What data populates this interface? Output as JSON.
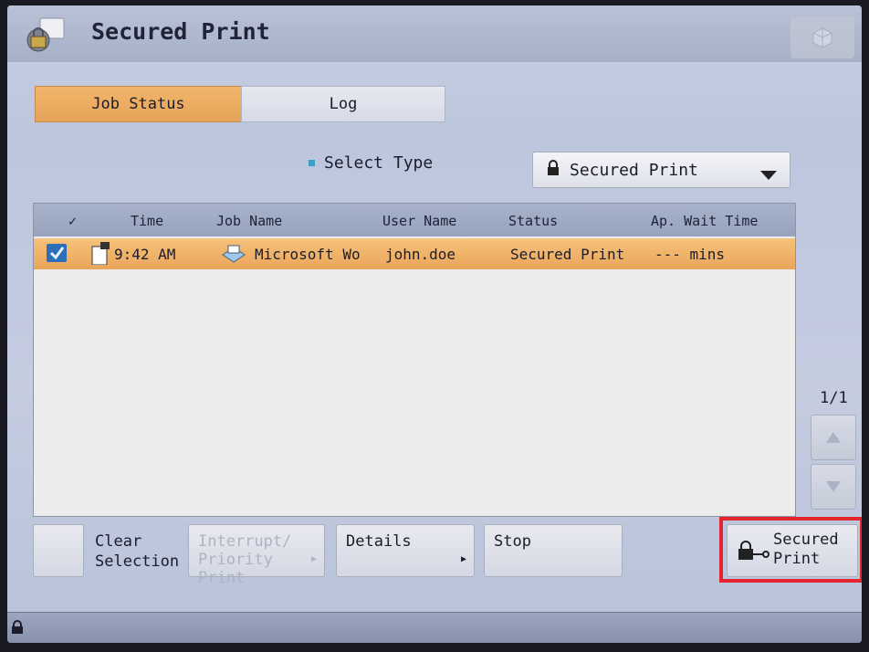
{
  "header": {
    "title": "Secured Print",
    "icon": "lock-icon"
  },
  "tabs": [
    {
      "label": "Job Status",
      "active": true
    },
    {
      "label": "Log",
      "active": false
    }
  ],
  "filter": {
    "label": "Select Type",
    "selected": "Secured Print"
  },
  "table": {
    "columns": [
      "✓",
      "Time",
      "Job Name",
      "User Name",
      "Status",
      "Ap. Wait Time"
    ],
    "rows": [
      {
        "time": "9:42 AM",
        "job_name": "Microsoft Wo",
        "user_name": "john.doe",
        "status": "Secured Print",
        "wait_time": "--- mins",
        "selected": true
      }
    ]
  },
  "pagination": {
    "indicator": "1/1"
  },
  "buttons": {
    "clear_selection": "Clear Selection",
    "clear_line1": "Clear",
    "clear_line2": "Selection",
    "interrupt_line1": "Interrupt/",
    "interrupt_line2": "Priority Print",
    "details": "Details",
    "stop": "Stop",
    "secured_line1": "Secured",
    "secured_line2": "Print"
  },
  "colors": {
    "accent": "#eaa55a",
    "highlight_border": "#e4252f"
  }
}
